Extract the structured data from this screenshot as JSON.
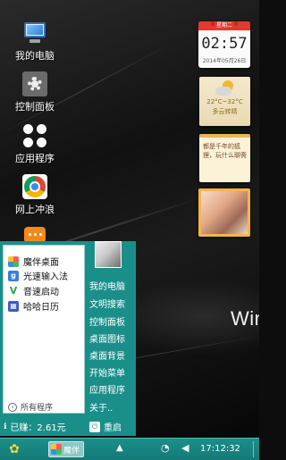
{
  "desktop": {
    "icons": [
      {
        "label": "我的电脑",
        "icon": "computer-icon"
      },
      {
        "label": "控制面板",
        "icon": "gear-icon"
      },
      {
        "label": "应用程序",
        "icon": "apps-icon"
      },
      {
        "label": "网上冲浪",
        "icon": "chrome-icon"
      },
      {
        "label": "",
        "icon": "chat-icon"
      }
    ],
    "brand_text": "Win"
  },
  "widgets": {
    "clock": {
      "weekday": "星期二",
      "time": "02:57",
      "date": "2014年05月26日"
    },
    "weather": {
      "temp": "22°C~32°C",
      "condition": "多云转晴"
    },
    "note": {
      "text": "都是千年的狐狸，玩什么聊斋"
    }
  },
  "start_menu": {
    "items": [
      {
        "label": "魔伴桌面",
        "icon": "pinwheel-icon",
        "color": "#f4a325"
      },
      {
        "label": "光速输入法",
        "icon": "g-keyboard-icon",
        "color": "#3b7dd8"
      },
      {
        "label": "音速启动",
        "icon": "v-launch-icon",
        "color": "#2aa84a"
      },
      {
        "label": "哈哈日历",
        "icon": "calendar-icon",
        "color": "#3a5bbf"
      }
    ],
    "all_programs": "所有程序",
    "right_items": [
      "我的电脑",
      "文明搜索",
      "控制面板",
      "桌面图标",
      "桌面背景",
      "开始菜单",
      "应用程序",
      "关于.."
    ],
    "earned": "已赚：2.61元",
    "restart": "重启"
  },
  "taskbar": {
    "app_label": "魔伴",
    "time": "17:12:32"
  },
  "colors": {
    "accent": "#1a8f8a",
    "clock_header": "#e23b2e"
  }
}
